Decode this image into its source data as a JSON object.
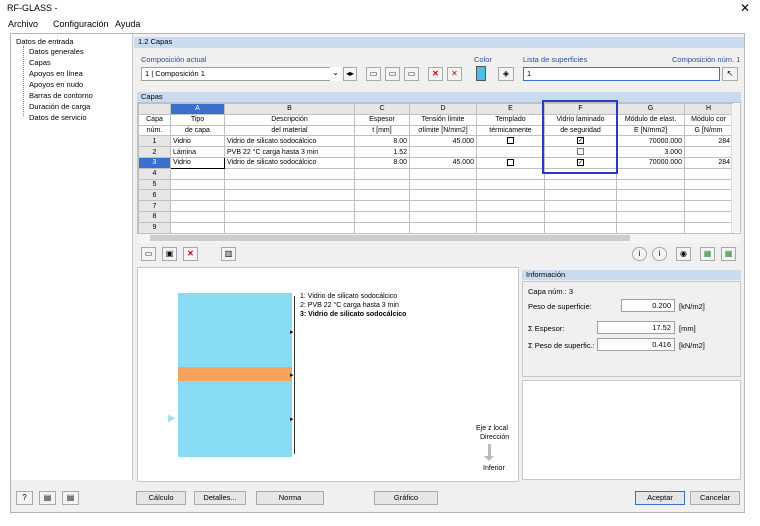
{
  "window": {
    "title": "RF-GLASS -",
    "close_glyph": "✕"
  },
  "menu": [
    "Archivo",
    "Configuración",
    "Ayuda"
  ],
  "tree": {
    "root": "Datos de entrada",
    "items": [
      "Datos generales",
      "Capas",
      "Apoyos en línea",
      "Apoyos en nudo",
      "Barras de contorno",
      "Duración de carga",
      "Datos de servicio"
    ]
  },
  "section_title": "1.2 Capas",
  "composition": {
    "label": "Composición actual",
    "value": "1 | Composición 1",
    "color_label": "Color",
    "surface_list_label": "Lista de superficies",
    "composition_no_label": "Composición núm. 1",
    "surface_list_value": "1"
  },
  "layers": {
    "title": "Capas",
    "col_letters": [
      "A",
      "B",
      "C",
      "D",
      "E",
      "F",
      "G",
      "H"
    ],
    "header_row1": [
      "Capa",
      "Tipo",
      "Descripción",
      "Espesor",
      "Tensión límite",
      "Templado",
      "Vidrio laminado",
      "Módulo de elast.",
      "Módulo cor"
    ],
    "header_row2": [
      "núm.",
      "de capa",
      "del material",
      "t [mm]",
      "σlímite [N/mm2]",
      "térmicamente",
      "de seguridad",
      "E [N/mm2]",
      "G [N/mm"
    ],
    "rows": [
      {
        "n": "1",
        "type": "Vidrio",
        "desc": "Vidrio de silicato sodocálcico",
        "t": "8.00",
        "sigma": "45.000",
        "tempered": false,
        "laminated": true,
        "E": "70000.000",
        "G": "284"
      },
      {
        "n": "2",
        "type": "Lámina",
        "desc": "PVB 22 °C carga hasta 3 min",
        "t": "1.52",
        "sigma": "",
        "tempered": null,
        "laminated": false,
        "E": "3.000",
        "G": ""
      },
      {
        "n": "3",
        "type": "Vidrio",
        "desc": "Vidrio de silicato sodocálcico",
        "t": "8.00",
        "sigma": "45.000",
        "tempered": false,
        "laminated": true,
        "E": "70000.000",
        "G": "284"
      },
      {
        "n": "4"
      },
      {
        "n": "5"
      },
      {
        "n": "6"
      },
      {
        "n": "7"
      },
      {
        "n": "8"
      },
      {
        "n": "9"
      }
    ]
  },
  "legend": {
    "l1": "1: Vidrio de silicato sodocálcico",
    "l2": "2: PVB 22 °C carga hasta 3 min",
    "l3": "3: Vidrio de silicato sodocálcico",
    "axis1": "Eje z local",
    "axis2": "Dirección",
    "axis3": "Inferior"
  },
  "info": {
    "title": "Información",
    "layer_no": "Capa núm.: 3",
    "weight_label": "Peso de superficie:",
    "weight_value": "0.200",
    "weight_unit": "[kN/m2]",
    "thick_label": "Σ Espesor:",
    "thick_value": "17.52",
    "thick_unit": "[mm]",
    "sum_weight_label": "Σ Peso de superfic.:",
    "sum_weight_value": "0.416",
    "sum_weight_unit": "[kN/m2]"
  },
  "buttons": {
    "calc": "Cálculo",
    "details": "Detalles...",
    "norm": "Norma",
    "graphic": "Gráfico",
    "ok": "Aceptar",
    "cancel": "Cancelar"
  },
  "colors": {
    "glass": "#87dcf4",
    "film": "#f6a35e",
    "selection": "#3a6fcf",
    "header_band": "#c9dcef"
  }
}
